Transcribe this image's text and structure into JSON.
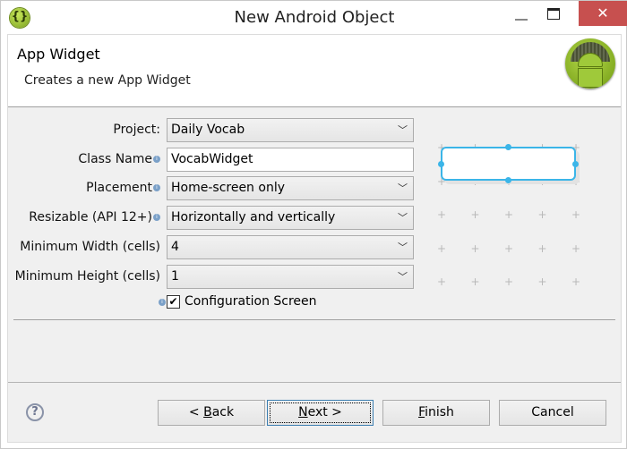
{
  "window": {
    "title": "New Android Object",
    "close_glyph": "✕"
  },
  "header": {
    "title": "App Widget",
    "description": "Creates a new App Widget"
  },
  "form": {
    "project": {
      "label": "Project:",
      "value": "Daily Vocab"
    },
    "class_name": {
      "label": "Class Name",
      "value": "VocabWidget"
    },
    "placement": {
      "label": "Placement",
      "value": "Home-screen only"
    },
    "resizable": {
      "label": "Resizable (API 12+)",
      "value": "Horizontally and vertically"
    },
    "min_width": {
      "label": "Minimum Width (cells)",
      "value": "4"
    },
    "min_height": {
      "label": "Minimum Height (cells)",
      "value": "1"
    },
    "config_screen": {
      "label": "Configuration Screen",
      "checked": true
    }
  },
  "preview": {
    "accent": "#3bb5e8",
    "widget_cells_wide": 4,
    "widget_cells_high": 1
  },
  "buttons": {
    "back": {
      "pre": "< ",
      "mn": "B",
      "post": "ack"
    },
    "next": {
      "pre": "",
      "mn": "N",
      "post": "ext >"
    },
    "finish": {
      "pre": "",
      "mn": "F",
      "post": "inish"
    },
    "cancel": "Cancel"
  },
  "colors": {
    "close_button": "#c7504f",
    "background": "#f0f0f0"
  }
}
